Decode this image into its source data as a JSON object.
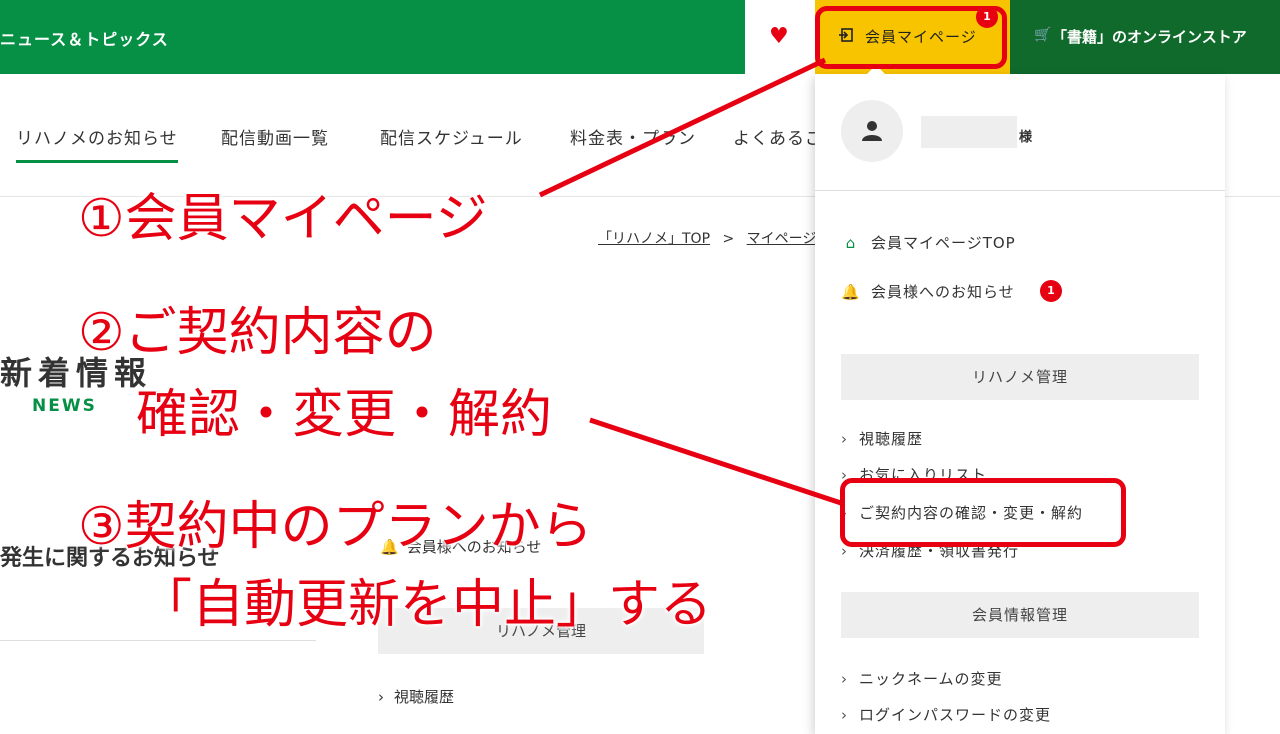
{
  "header": {
    "news_topics": "ニュース＆トピックス",
    "mypage_label": "会員マイページ",
    "mypage_badge": "1",
    "store_label": "「書籍」のオンラインストア",
    "icons": [
      "heart-icon",
      "login-icon",
      "cart-icon"
    ],
    "colors": {
      "green": "#069046",
      "dark_green": "#0f6a2c",
      "yellow": "#f8c400",
      "red": "#e60012"
    }
  },
  "nav": {
    "items": [
      {
        "label": "リハノメのお知らせ",
        "active": true
      },
      {
        "label": "配信動画一覧"
      },
      {
        "label": "配信スケジュール"
      },
      {
        "label": "料金表・プラン"
      },
      {
        "label": "よくあるご"
      }
    ]
  },
  "breadcrumb": {
    "home": "「リハノメ」TOP",
    "separator": ">",
    "current": "マイページ"
  },
  "news": {
    "heading": "新着情報",
    "heading_en": "NEWS",
    "item": "発生に関するお知らせ"
  },
  "background_sidebar": {
    "notice": "会員様へのお知らせ",
    "section": "リハノメ管理",
    "first_link": "視聴履歴"
  },
  "dropdown": {
    "honorific": "様",
    "top_link": "会員マイページTOP",
    "notice_link": "会員様へのお知らせ",
    "notice_badge": "1",
    "section_rihanome": "リハノメ管理",
    "rihanome_links": [
      "視聴履歴",
      "お気に入りリスト",
      "ご契約内容の確認・変更・解約",
      "決済履歴・領収書発行"
    ],
    "section_member": "会員情報管理",
    "member_links": [
      "ニックネームの変更",
      "ログインパスワードの変更"
    ]
  },
  "annotations": {
    "step1": "①会員マイページ",
    "step2_line1": "②ご契約内容の",
    "step2_line2": "確認・変更・解約",
    "step3_line1": "③契約中のプランから",
    "step3_line2": "「自動更新を中止」する"
  }
}
